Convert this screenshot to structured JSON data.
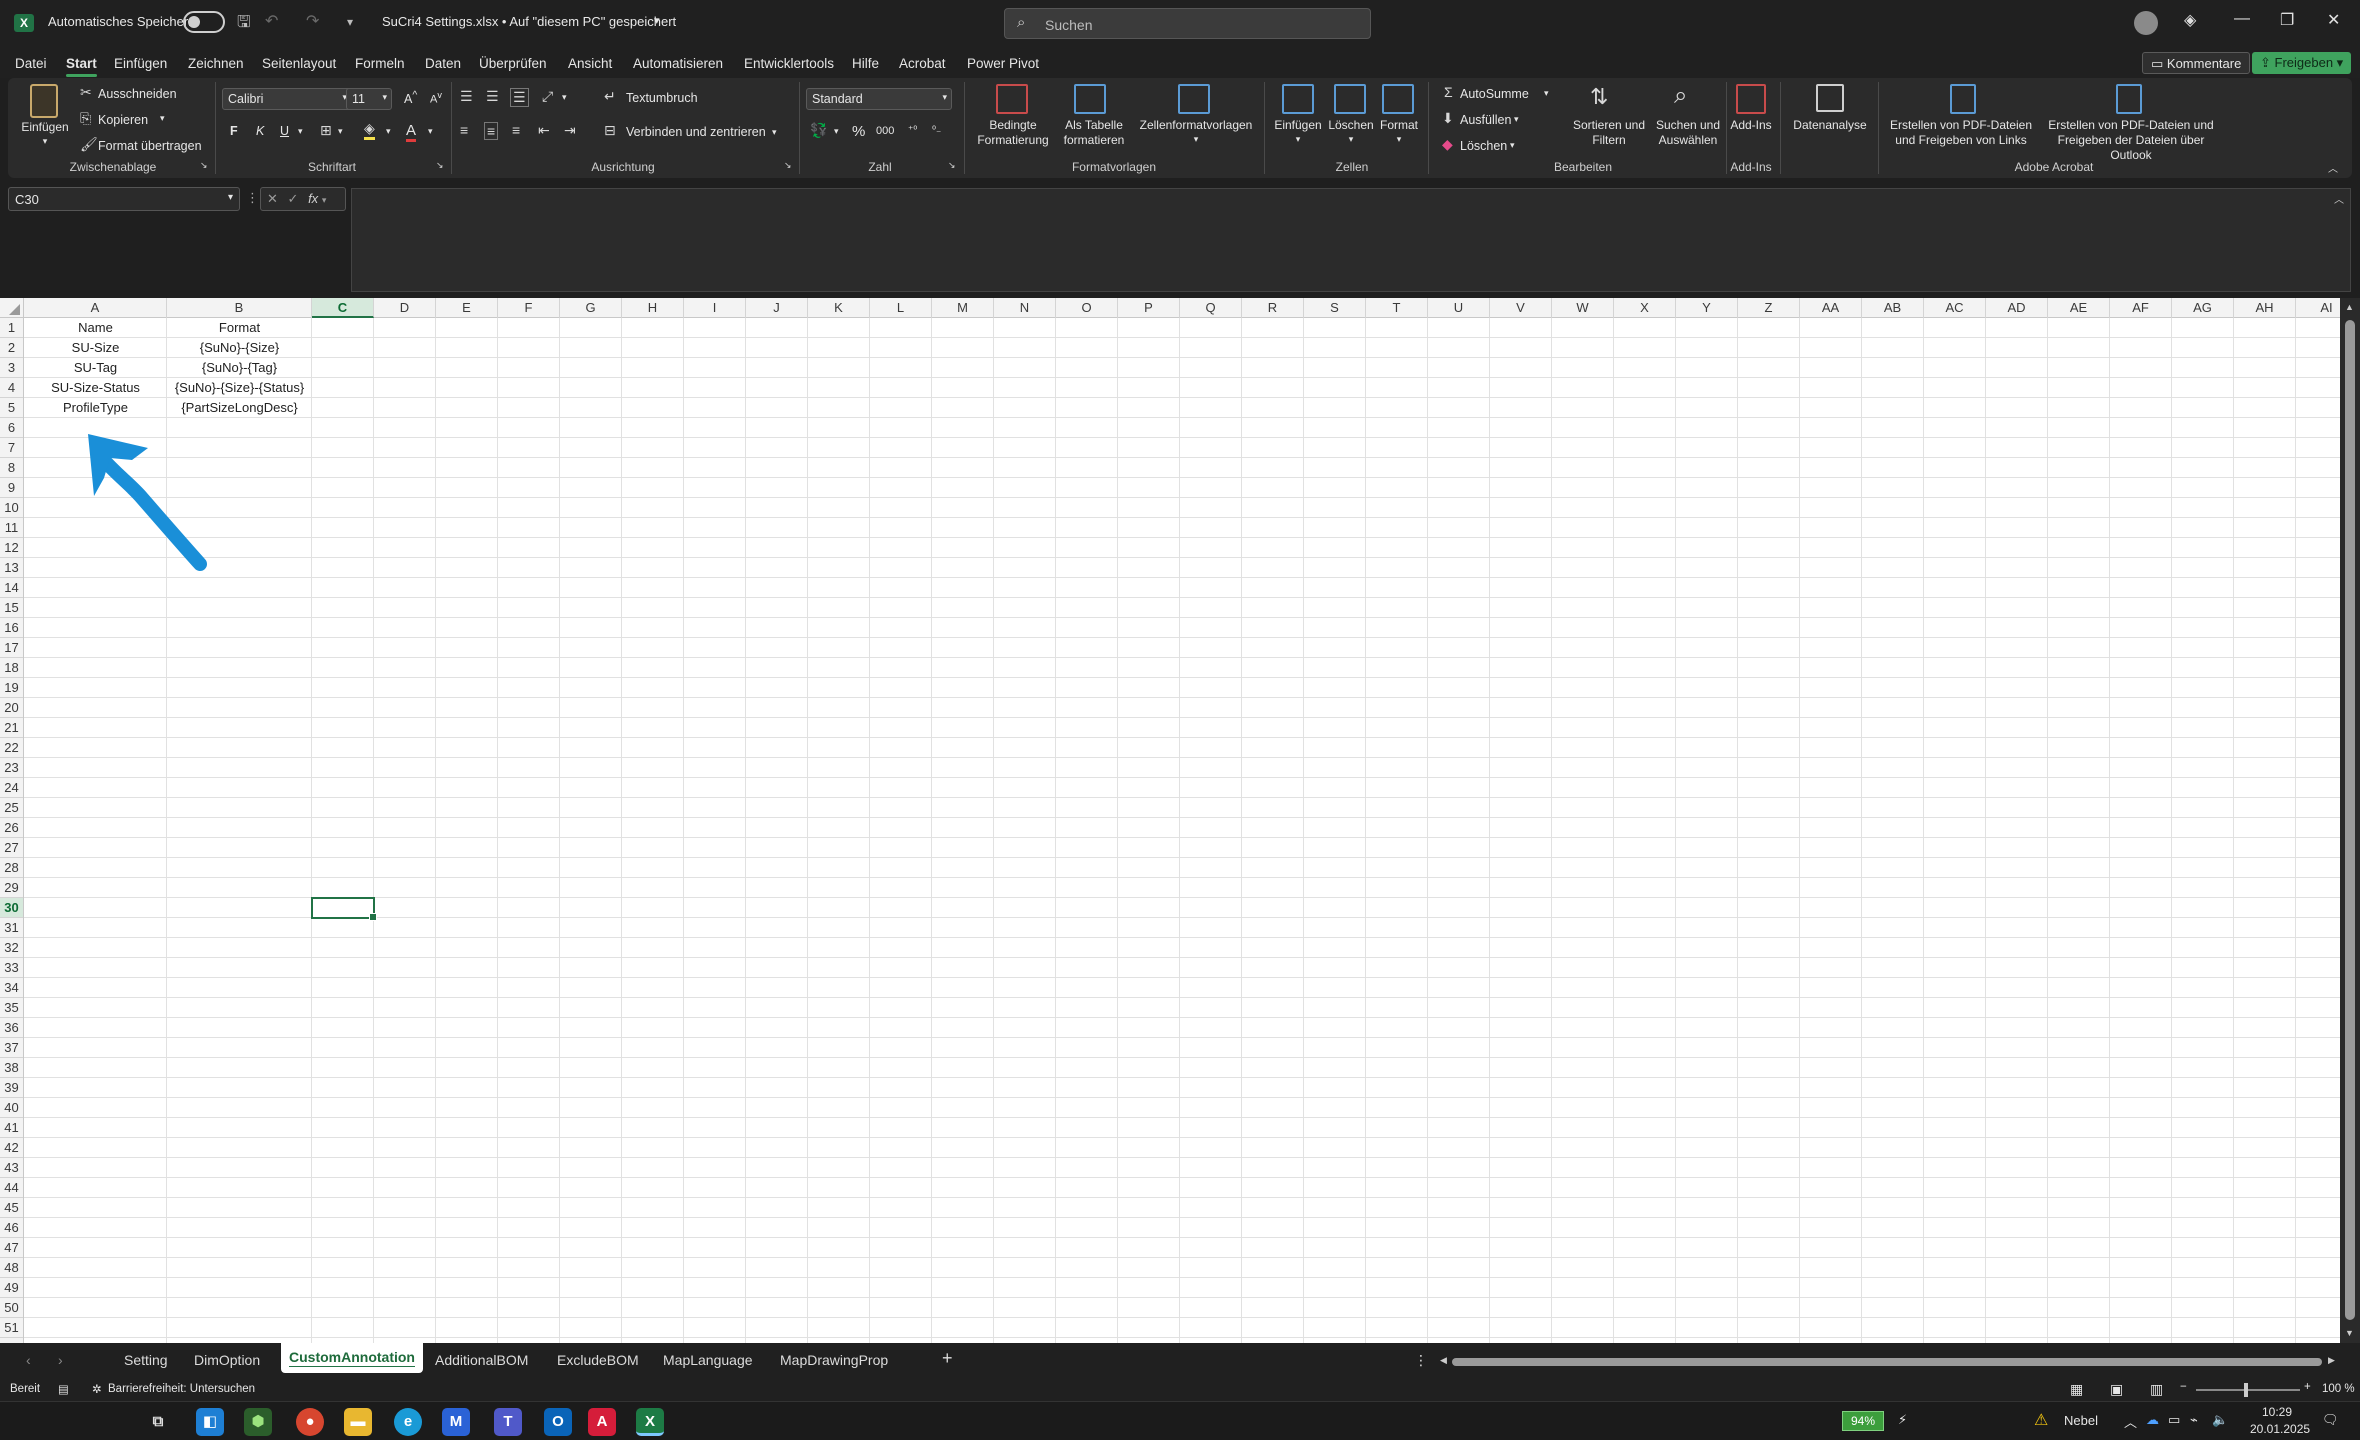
{
  "titlebar": {
    "autosave_label": "Automatisches Speichern",
    "filename": "SuCri4 Settings.xlsx • Auf \"diesem PC\" gespeichert",
    "search_placeholder": "Suchen"
  },
  "menu": {
    "items": [
      "Datei",
      "Start",
      "Einfügen",
      "Zeichnen",
      "Seitenlayout",
      "Formeln",
      "Daten",
      "Überprüfen",
      "Ansicht",
      "Automatisieren",
      "Entwicklertools",
      "Hilfe",
      "Acrobat",
      "Power Pivot"
    ],
    "active": "Start",
    "comments_button": "Kommentare",
    "share_button": "Freigeben"
  },
  "ribbon": {
    "clipboard": {
      "paste": "Einfügen",
      "cut": "Ausschneiden",
      "copy": "Kopieren",
      "format_painter": "Format übertragen",
      "group": "Zwischenablage"
    },
    "font": {
      "name": "Calibri",
      "size": "11",
      "bold": "F",
      "italic": "K",
      "underline": "U",
      "group": "Schriftart"
    },
    "alignment": {
      "wrap": "Textumbruch",
      "merge": "Verbinden und zentrieren",
      "group": "Ausrichtung"
    },
    "number": {
      "format": "Standard",
      "group": "Zahl"
    },
    "styles": {
      "conditional": "Bedingte Formatierung",
      "as_table": "Als Tabelle formatieren",
      "cell_styles": "Zellenformatvorlagen",
      "group": "Formatvorlagen"
    },
    "cells": {
      "insert": "Einfügen",
      "delete": "Löschen",
      "format": "Format",
      "group": "Zellen"
    },
    "editing": {
      "autosum": "AutoSumme",
      "fill": "Ausfüllen",
      "clear": "Löschen",
      "sort": "Sortieren und Filtern",
      "find": "Suchen und Auswählen",
      "group": "Bearbeiten"
    },
    "addins": {
      "addins": "Add-Ins",
      "group": "Add-Ins"
    },
    "analysis": {
      "label": "Datenanalyse"
    },
    "acrobat": {
      "create_links": "Erstellen von PDF-Dateien und Freigeben von Links",
      "create_outlook": "Erstellen von PDF-Dateien und Freigeben der Dateien über Outlook",
      "group": "Adobe Acrobat"
    }
  },
  "formula_bar": {
    "namebox": "C30",
    "fx": "fx",
    "content": ""
  },
  "sheet": {
    "columns": [
      "A",
      "B",
      "C",
      "D",
      "E",
      "F",
      "G",
      "H",
      "I",
      "J",
      "K",
      "L",
      "M",
      "N",
      "O",
      "P",
      "Q",
      "R",
      "S",
      "T",
      "U",
      "V",
      "W",
      "X",
      "Y",
      "Z",
      "AA",
      "AB",
      "AC",
      "AD",
      "AE",
      "AF",
      "AG",
      "AH",
      "AI"
    ],
    "selected_column": "C",
    "selected_row": 30,
    "row_count": 51,
    "cells": {
      "A1": "Name",
      "B1": "Format",
      "A2": "SU-Size",
      "B2": "{SuNo}-{Size}",
      "A3": "SU-Tag",
      "B3": "{SuNo}-{Tag}",
      "A4": "SU-Size-Status",
      "B4": "{SuNo}-{Size}-{Status}",
      "A5": "ProfileType",
      "B5": "{PartSizeLongDesc}"
    },
    "annotation_arrow_color": "#1a8fd8"
  },
  "tabs": {
    "items": [
      "Setting",
      "DimOption",
      "CustomAnnotation",
      "AdditionalBOM",
      "ExcludeBOM",
      "MapLanguage",
      "MapDrawingProp"
    ],
    "active": "CustomAnnotation"
  },
  "status": {
    "ready": "Bereit",
    "accessibility": "Barrierefreiheit: Untersuchen",
    "zoom": "100 %"
  },
  "taskbar": {
    "battery": "94%",
    "weather": "Nebel",
    "time": "10:29",
    "date": "20.01.2025"
  },
  "colors": {
    "accent": "#217346",
    "share_green": "#3fa35e"
  }
}
